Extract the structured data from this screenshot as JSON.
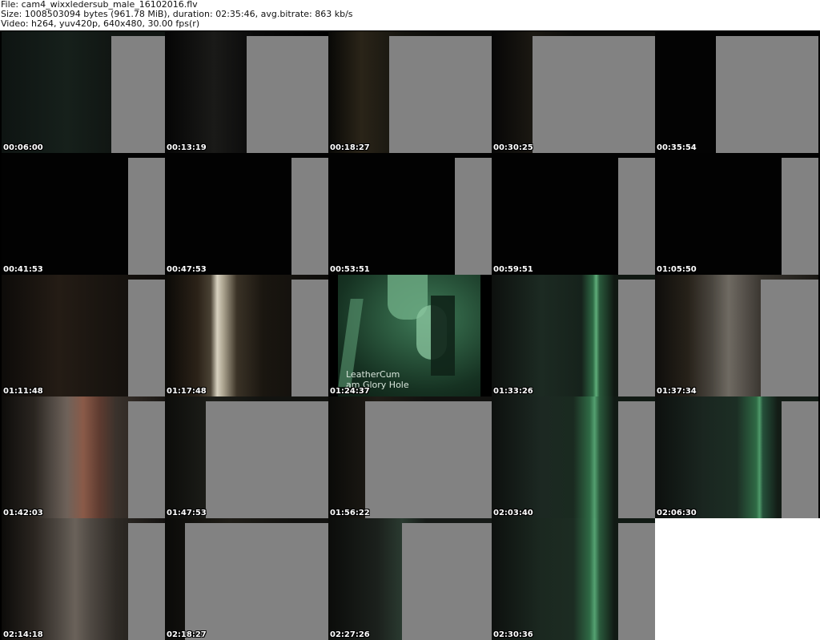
{
  "header": {
    "file_line": "File: cam4_wixxledersub_male_16102016.flv",
    "size_line": "Size: 1008503094 bytes (961.78 MiB), duration: 02:35:46, avg.bitrate: 863 kb/s",
    "video_line": "Video: h264, yuv420p, 640x480, 30.00 fps(r)"
  },
  "thumbnails": [
    {
      "timestamp": "00:06:00"
    },
    {
      "timestamp": "00:13:19"
    },
    {
      "timestamp": "00:18:27"
    },
    {
      "timestamp": "00:30:25"
    },
    {
      "timestamp": "00:35:54"
    },
    {
      "timestamp": "00:41:53"
    },
    {
      "timestamp": "00:47:53"
    },
    {
      "timestamp": "00:53:51"
    },
    {
      "timestamp": "00:59:51"
    },
    {
      "timestamp": "01:05:50"
    },
    {
      "timestamp": "01:11:48"
    },
    {
      "timestamp": "01:17:48"
    },
    {
      "timestamp": "01:24:37",
      "overlay_line1": "LeatherCum",
      "overlay_line2": "am Glory Hole"
    },
    {
      "timestamp": "01:33:26"
    },
    {
      "timestamp": "01:37:34"
    },
    {
      "timestamp": "01:42:03"
    },
    {
      "timestamp": "01:47:53"
    },
    {
      "timestamp": "01:56:22"
    },
    {
      "timestamp": "02:03:40"
    },
    {
      "timestamp": "02:06:30"
    },
    {
      "timestamp": "02:14:18"
    },
    {
      "timestamp": "02:18:27"
    },
    {
      "timestamp": "02:27:26"
    },
    {
      "timestamp": "02:30:36"
    }
  ],
  "colors": {
    "background": "#ffffff",
    "grid_background": "#000000",
    "gray_panel": "#828282",
    "night_vision_green": "#2f5a40",
    "timestamp_text": "#ffffff"
  }
}
